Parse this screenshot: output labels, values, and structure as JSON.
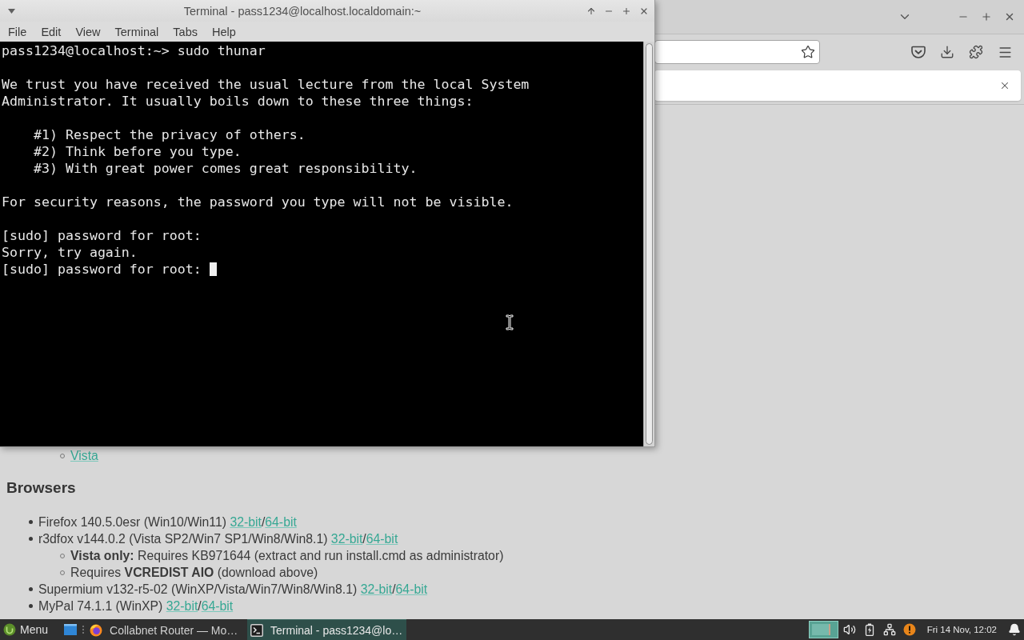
{
  "terminal": {
    "title": "Terminal - pass1234@localhost.localdomain:~",
    "menu": [
      "File",
      "Edit",
      "View",
      "Terminal",
      "Tabs",
      "Help"
    ],
    "output": [
      [
        "pass1234@localhost:~> sudo thunar"
      ],
      [
        "We trust you have received the usual lecture from the local System",
        "Administrator. It usually boils down to these three things:"
      ],
      [
        "    #1) Respect the privacy of others.",
        "    #2) Think before you type.",
        "    #3) With great power comes great responsibility."
      ],
      [
        "For security reasons, the password you type will not be visible."
      ],
      [
        "[sudo] password for root:",
        "Sorry, try again.",
        "[sudo] password for root:"
      ]
    ],
    "cursor_visible": true
  },
  "web_page": {
    "blocks": [
      {
        "kind": "list",
        "items": [
          {
            "children": [
              {
                "parts": [
                  {
                    "kind": "link",
                    "text": "Vista"
                  }
                ]
              }
            ]
          }
        ]
      },
      {
        "kind": "heading",
        "text": "Browsers"
      },
      {
        "kind": "list",
        "items": [
          {
            "parts": [
              {
                "kind": "text",
                "text": "Firefox 140.5.0esr (Win10/Win11) "
              },
              {
                "kind": "link",
                "text": "32-bit"
              },
              {
                "kind": "text",
                "text": "/"
              },
              {
                "kind": "link",
                "text": "64-bit"
              }
            ]
          },
          {
            "parts": [
              {
                "kind": "text",
                "text": "r3dfox v144.0.2 (Vista SP2/Win7 SP1/Win8/Win8.1) "
              },
              {
                "kind": "link",
                "text": "32-bit"
              },
              {
                "kind": "text",
                "text": "/"
              },
              {
                "kind": "link",
                "text": "64-bit"
              }
            ],
            "children": [
              {
                "parts": [
                  {
                    "kind": "text",
                    "text": "**Vista only:** Requires KB971644 (extract and run install.cmd as administrator)"
                  }
                ]
              },
              {
                "parts": [
                  {
                    "kind": "text",
                    "text": "Requires **VCREDIST AIO** (download above)"
                  }
                ]
              }
            ]
          },
          {
            "parts": [
              {
                "kind": "text",
                "text": "Supermium v132-r5-02 (WinXP/Vista/Win7/Win8/Win8.1) "
              },
              {
                "kind": "link",
                "text": "32-bit"
              },
              {
                "kind": "text",
                "text": "/"
              },
              {
                "kind": "link",
                "text": "64-bit"
              }
            ]
          },
          {
            "parts": [
              {
                "kind": "text",
                "text": "MyPal 74.1.1 (WinXP) "
              },
              {
                "kind": "link",
                "text": "32-bit"
              },
              {
                "kind": "text",
                "text": "/"
              },
              {
                "kind": "link",
                "text": "64-bit"
              }
            ]
          }
        ]
      }
    ]
  },
  "taskbar": {
    "menu_label": "Menu",
    "tasks": [
      {
        "kind": "browser",
        "label": "Collabnet Router — Mo…",
        "selected": false
      },
      {
        "kind": "terminal",
        "label": "Terminal - pass1234@lo…",
        "selected": true
      }
    ],
    "clock": "Fri 14 Nov, 12:02"
  }
}
